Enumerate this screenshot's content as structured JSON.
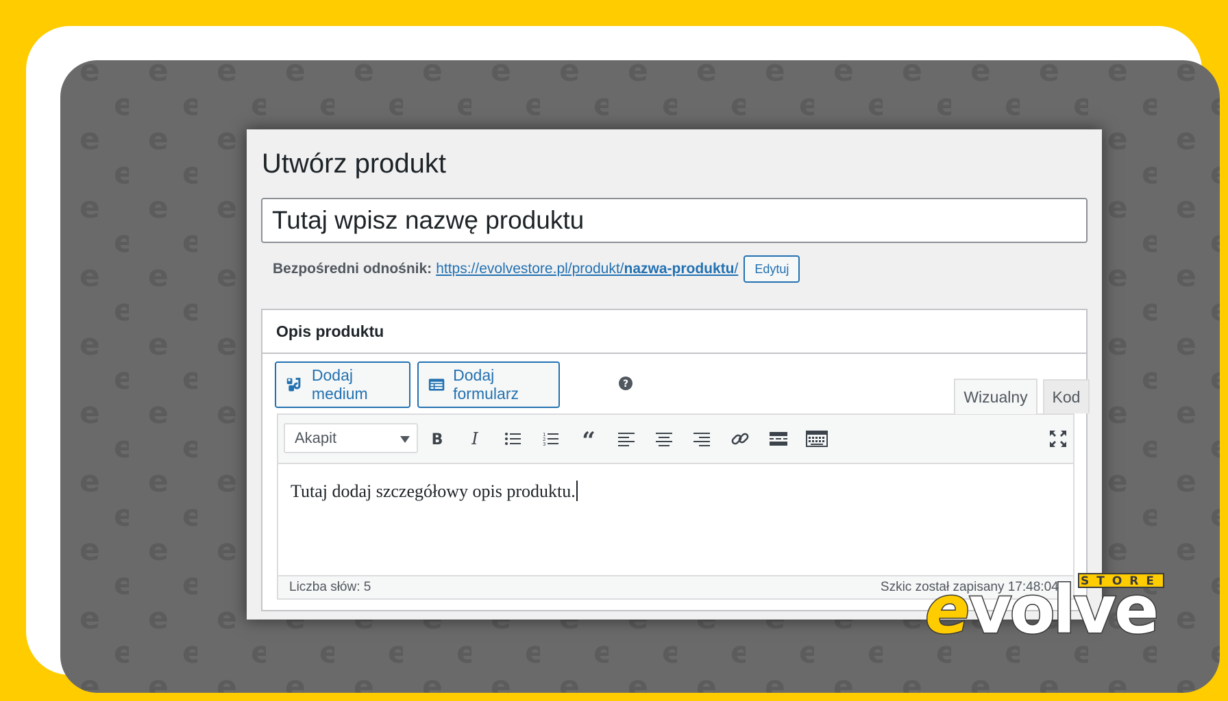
{
  "page": {
    "title": "Utwórz produkt",
    "product_name_value": "Tutaj wpisz nazwę produktu"
  },
  "permalink": {
    "label": "Bezpośredni odnośnik:",
    "url_base": "https://evolvestore.pl/produkt/",
    "url_slug": "nazwa-produktu",
    "url_trailing": "/",
    "edit_label": "Edytuj"
  },
  "description_box": {
    "heading": "Opis produktu",
    "add_media_label": "Dodaj medium",
    "add_form_label": "Dodaj formularz",
    "help_icon": "question-circle-icon",
    "tabs": [
      {
        "label": "Wizualny",
        "active": true
      },
      {
        "label": "Kod",
        "active": false
      }
    ],
    "toolbar": {
      "format_selected": "Akapit",
      "buttons": [
        "bold",
        "italic",
        "bulleted-list",
        "numbered-list",
        "blockquote",
        "align-left",
        "align-center",
        "align-right",
        "link",
        "read-more",
        "toolbar-toggle",
        "fullscreen"
      ]
    },
    "content_text": "Tutaj dodaj szczegółowy opis produktu.",
    "word_count": "Liczba słów: 5",
    "draft_status": "Szkic został zapisany 17:48:04."
  },
  "brand": {
    "logo_main": "evolve",
    "logo_tag": "STORE",
    "colors": {
      "yellow": "#FFCC00",
      "wp_blue": "#2271b1",
      "dark_bg": "#6a6a6a"
    }
  }
}
